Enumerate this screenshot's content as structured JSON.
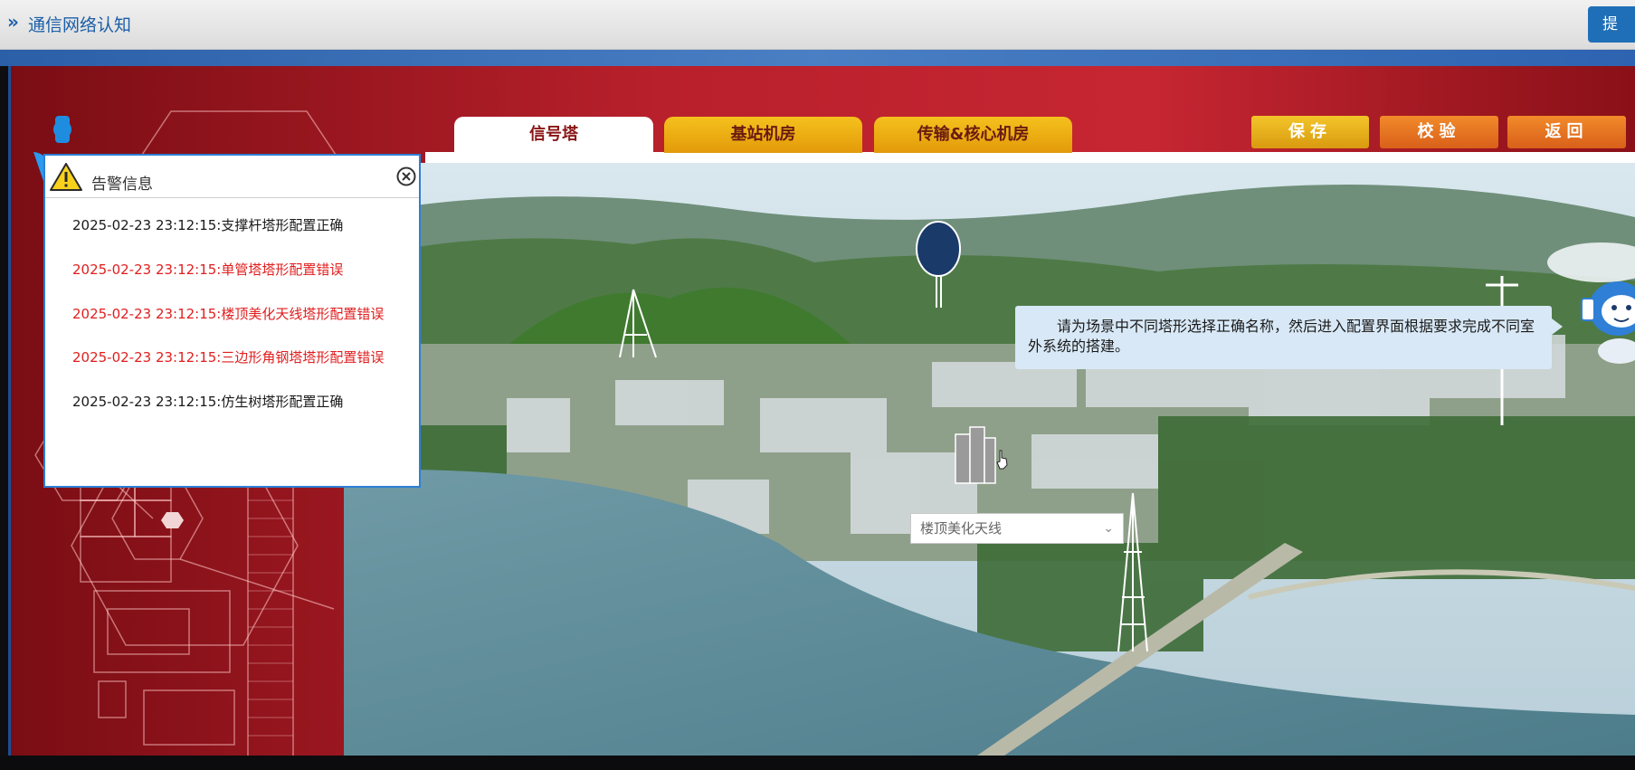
{
  "app": {
    "title": "通信网络认知",
    "submit_label": "提"
  },
  "tabs": [
    {
      "label": "信号塔",
      "active": true
    },
    {
      "label": "基站机房",
      "active": false
    },
    {
      "label": "传输&核心机房",
      "active": false
    }
  ],
  "actions": {
    "save": "保存",
    "verify": "校验",
    "back": "返回"
  },
  "alarm": {
    "title": "告警信息",
    "messages": [
      {
        "text": "2025-02-23 23:12:15:支撑杆塔形配置正确",
        "status": "ok"
      },
      {
        "text": "2025-02-23 23:12:15:单管塔塔形配置错误",
        "status": "error"
      },
      {
        "text": "2025-02-23 23:12:15:楼顶美化天线塔形配置错误",
        "status": "error"
      },
      {
        "text": "2025-02-23 23:12:15:三边形角钢塔塔形配置错误",
        "status": "error"
      },
      {
        "text": "2025-02-23 23:12:15:仿生树塔形配置正确",
        "status": "ok"
      }
    ]
  },
  "tip": {
    "text": "请为场景中不同塔形选择正确名称，然后进入配置界面根据要求完成不同室外系统的搭建。"
  },
  "tower_select": {
    "value": "楼顶美化天线"
  },
  "colors": {
    "ok": "#1a1a1a",
    "error": "#e01e1e",
    "accent": "#1f6fb8",
    "tab_orange": "#f0b117"
  },
  "icons": {
    "header": "chevron-right-double-icon",
    "warning": "warning-icon",
    "close": "close-circle-icon",
    "dropdown": "chevron-down-icon"
  }
}
